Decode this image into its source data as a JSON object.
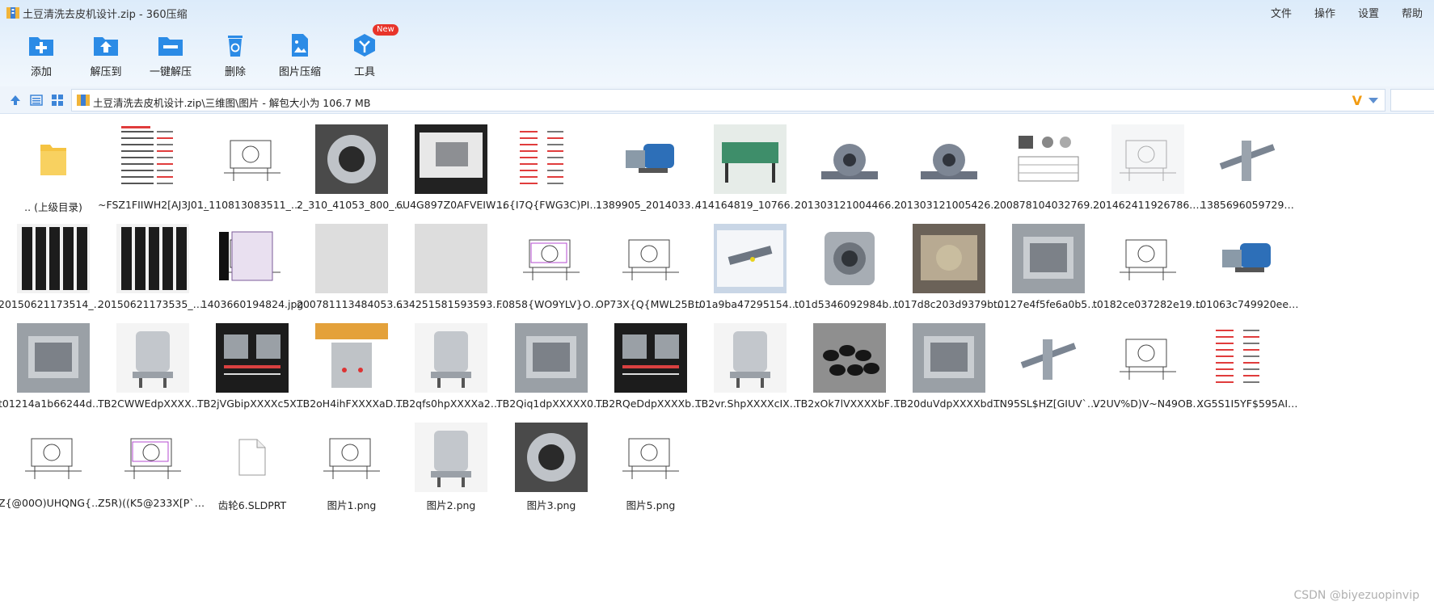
{
  "window": {
    "title": "土豆清洗去皮机设计.zip - 360压缩",
    "menus": [
      "文件",
      "操作",
      "设置",
      "帮助"
    ]
  },
  "toolbar": {
    "buttons": [
      {
        "label": "添加",
        "icon": "add-icon"
      },
      {
        "label": "解压到",
        "icon": "extract-to-icon"
      },
      {
        "label": "一键解压",
        "icon": "quick-extract-icon"
      },
      {
        "label": "删除",
        "icon": "recycle-bin-icon"
      },
      {
        "label": "图片压缩",
        "icon": "image-compress-icon"
      },
      {
        "label": "工具",
        "icon": "tools-icon"
      }
    ],
    "new_badge": "New"
  },
  "address": {
    "path": "土豆清洗去皮机设计.zip\\三维图\\图片 - 解包大小为 106.7 MB",
    "v_logo": "V"
  },
  "colors": {
    "accent": "#2b8be6",
    "titlebar": "#dcebfa",
    "folder": "#f5c342"
  },
  "files": [
    {
      "name": ".. (上级目录)",
      "kind": "folder"
    },
    {
      "name": "~FSZ1FIIWH2[AJ3J0(…",
      "kind": "spec-sheet"
    },
    {
      "name": "1_110813083511_1.jpg",
      "kind": "line-drawing"
    },
    {
      "name": "2_310_41053_800_60…",
      "kind": "drum-photo"
    },
    {
      "name": "6U4G897Z0AFVEIW}}…",
      "kind": "screen-photo"
    },
    {
      "name": "16{I7Q{FWG3C)PIDC`…",
      "kind": "red-text-sheet"
    },
    {
      "name": "1389905_201403301…",
      "kind": "motor-blue"
    },
    {
      "name": "414164819_1076696…",
      "kind": "machine-green"
    },
    {
      "name": "20130312100446601….",
      "kind": "bearing-gray"
    },
    {
      "name": "20130312100542652….",
      "kind": "bearing-gray2"
    },
    {
      "name": "200878104032769.jpg",
      "kind": "parts-table"
    },
    {
      "name": "201462411926786.jpg",
      "kind": "sketch-machine"
    },
    {
      "name": "1385696059729…",
      "kind": "shaft-cad"
    },
    {
      "name": "20150621173514_271…",
      "kind": "brush-rollers"
    },
    {
      "name": "20150621173535_646…",
      "kind": "brush-rollers2"
    },
    {
      "name": "1403660194824.jpg",
      "kind": "peeler-drawing"
    },
    {
      "name": "2007811134840535.jpg",
      "kind": "drum-frame"
    },
    {
      "name": "634251581593593​75…",
      "kind": "steel-drum"
    },
    {
      "name": "F0858{WO9YLV}OF}…",
      "kind": "layout-drawing"
    },
    {
      "name": "OP73X{Q{MWL25B9`…",
      "kind": "shaft-sketch"
    },
    {
      "name": "t01a9ba472951544d4…",
      "kind": "cad-window"
    },
    {
      "name": "t01d5346092984bac7…",
      "kind": "flange-bearing"
    },
    {
      "name": "t017d8c203d9379b6…",
      "kind": "potato-drum"
    },
    {
      "name": "t0127e4f5fe6a0b5a1…",
      "kind": "steel-interior"
    },
    {
      "name": "t0182ce037282e1924…",
      "kind": "assembly-sketch"
    },
    {
      "name": "t01063c749920ee…",
      "kind": "motor-blue2"
    },
    {
      "name": "t01214a1b66244de89…",
      "kind": "gray-photo"
    },
    {
      "name": "TB2CWWEdpXXXXb…",
      "kind": "peeler-steel"
    },
    {
      "name": "TB2jVGbipXXXXc5XX…",
      "kind": "spec-dark"
    },
    {
      "name": "TB2oH4ihFXXXXaDX…",
      "kind": "peeler-poster"
    },
    {
      "name": "TB2qfs0hpXXXXa2Xp…",
      "kind": "peeler-dark"
    },
    {
      "name": "TB2Qiq1dpXXXXX0X…",
      "kind": "steel-closeup"
    },
    {
      "name": "TB2RQeDdpXXXXbA…",
      "kind": "size-display"
    },
    {
      "name": "TB2vr.ShpXXXXcIXpX…",
      "kind": "steel-column"
    },
    {
      "name": "TB2xOk7lVXXXXbFXX…",
      "kind": "brush-discs"
    },
    {
      "name": "TB20duVdpXXXXbdX…",
      "kind": "steel-box"
    },
    {
      "name": "TN95SL$HZ[GIUV`B)…",
      "kind": "shaft-3d"
    },
    {
      "name": "V2UV%D)V~N49OB…",
      "kind": "section-drawing"
    },
    {
      "name": "XG5S1I5YF$595AI…",
      "kind": "red-text-sheet2"
    },
    {
      "name": "Z{@00O)UHQNG{V…",
      "kind": "peeler-outline"
    },
    {
      "name": "Z5R)((K5@233X[P`HL(…",
      "kind": "layout-drawing2"
    },
    {
      "name": "齿轮6.SLDPRT",
      "kind": "blank-file"
    },
    {
      "name": "图片1.png",
      "kind": "tall-drawing"
    },
    {
      "name": "图片2.png",
      "kind": "peeler-render"
    },
    {
      "name": "图片3.png",
      "kind": "drum-inside"
    },
    {
      "name": "图片5.png",
      "kind": "small-sketch"
    }
  ],
  "watermark": "CSDN @biyezuopinvip"
}
